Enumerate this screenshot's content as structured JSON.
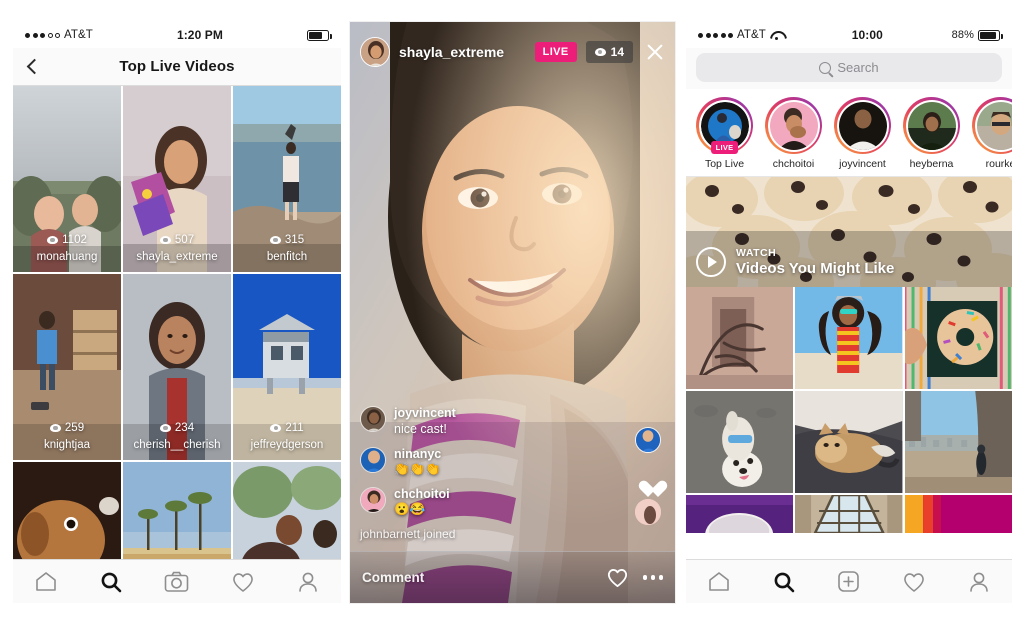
{
  "phones": {
    "left": {
      "status": {
        "carrier": "AT&T",
        "signal_filled": 3,
        "signal_total": 5,
        "time": "1:20 PM",
        "battery_pct": 70
      },
      "header": {
        "title": "Top Live Videos",
        "back_icon": "chevron-left-icon"
      },
      "grid": [
        {
          "views": "1102",
          "user": "monahuang"
        },
        {
          "views": "507",
          "user": "shayla_extreme"
        },
        {
          "views": "315",
          "user": "benfitch"
        },
        {
          "views": "259",
          "user": "knightjaa"
        },
        {
          "views": "234",
          "user": "cherish__cherish"
        },
        {
          "views": "211",
          "user": "jeffreydgerson"
        }
      ],
      "tabs": [
        {
          "icon": "home-icon",
          "active": false
        },
        {
          "icon": "search-icon",
          "active": true
        },
        {
          "icon": "camera-icon",
          "active": false
        },
        {
          "icon": "heart-icon",
          "active": false
        },
        {
          "icon": "profile-icon",
          "active": false
        }
      ]
    },
    "middle": {
      "broadcast": {
        "username": "shayla_extreme",
        "live_label": "LIVE",
        "viewer_count": "14",
        "viewer_icon": "eye-icon",
        "close_icon": "close-icon",
        "avatar_name": "broadcaster-avatar"
      },
      "comments": [
        {
          "user": "joyvincent",
          "text": "nice cast!"
        },
        {
          "user": "ninanyc",
          "text": "👏👏👏"
        },
        {
          "user": "chchoitoi",
          "text": "😮😂"
        }
      ],
      "join_notice": "johnbarnett joined",
      "composer": {
        "placeholder": "Comment",
        "heart_icon": "heart-outline-icon",
        "more_icon": "more-options-icon"
      }
    },
    "right": {
      "status": {
        "carrier": "AT&T",
        "signal_filled": 5,
        "signal_total": 5,
        "time": "10:00",
        "battery_text": "88%",
        "battery_pct": 88,
        "wifi_icon": "wifi-icon"
      },
      "search": {
        "placeholder": "Search",
        "icon": "search-icon"
      },
      "stories": [
        {
          "name": "Top Live",
          "badge": "LIVE"
        },
        {
          "name": "chchoitoi",
          "badge": ""
        },
        {
          "name": "joyvincent",
          "badge": ""
        },
        {
          "name": "heyberna",
          "badge": ""
        },
        {
          "name": "rourke",
          "badge": ""
        }
      ],
      "watch_banner": {
        "kicker": "WATCH",
        "title": "Videos You Might Like",
        "play_icon": "play-icon"
      },
      "tabs": [
        {
          "icon": "home-icon",
          "active": false
        },
        {
          "icon": "search-icon",
          "active": true
        },
        {
          "icon": "add-post-icon",
          "active": false
        },
        {
          "icon": "heart-icon",
          "active": false
        },
        {
          "icon": "profile-icon",
          "active": false
        }
      ]
    }
  },
  "colors": {
    "live_magenta": "#ED1E79",
    "story_ring_start": "#f9a03c",
    "story_ring_end": "#8a3ab9",
    "chrome_bg": "#fafafa",
    "text_primary": "#262626"
  }
}
